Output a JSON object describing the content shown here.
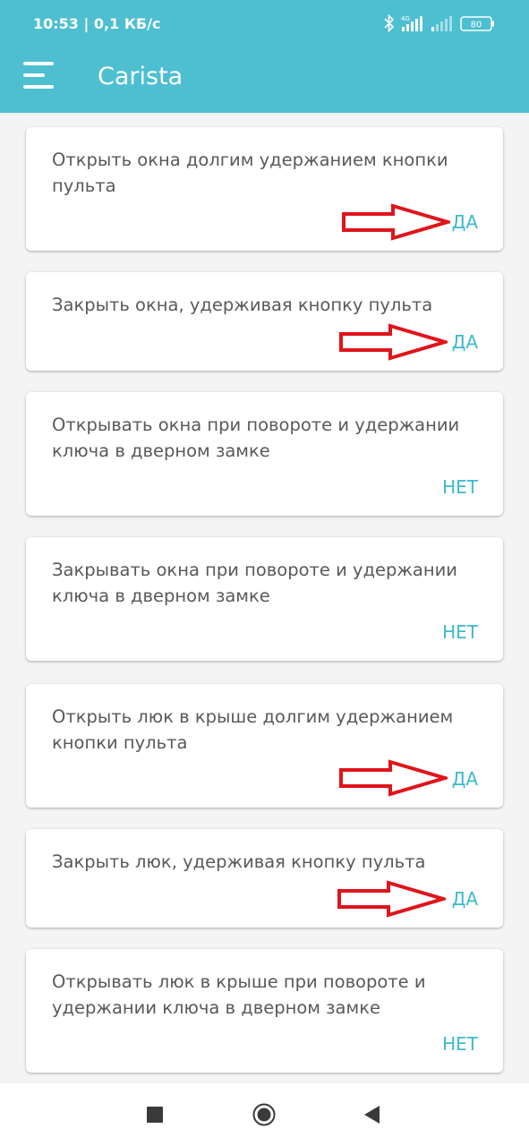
{
  "status_bar": {
    "time": "10:53 | 0,1 КБ/с",
    "network": "4G",
    "battery": "80",
    "icons": [
      "bluetooth-icon",
      "signal-4g-icon",
      "signal-icon",
      "battery-icon"
    ]
  },
  "app_bar": {
    "title": "Carista",
    "menu_icon": "hamburger-menu-icon"
  },
  "settings": [
    {
      "label": "Открыть окна долгим удержанием кнопки пульта",
      "value": "ДА",
      "annotated": true
    },
    {
      "label": "Закрыть окна, удерживая кнопку пульта",
      "value": "ДА",
      "annotated": true
    },
    {
      "label": "Открывать окна при повороте и удержании ключа в дверном замке",
      "value": "НЕТ",
      "annotated": false
    },
    {
      "label": "Закрывать окна при повороте и удержании ключа в дверном замке",
      "value": "НЕТ",
      "annotated": false
    },
    {
      "label": "Открыть люк в крыше долгим удержанием кнопки пульта",
      "value": "ДА",
      "annotated": true
    },
    {
      "label": "Закрыть люк, удерживая кнопку пульта",
      "value": "ДА",
      "annotated": true
    },
    {
      "label": "Открывать люк в крыше при повороте и удержании ключа в дверном замке",
      "value": "НЕТ",
      "annotated": false
    }
  ],
  "colors": {
    "header": "#4dbfd0",
    "accent": "#3db9cc",
    "annotation_arrow": "#e0141b",
    "background": "#f4f4f4"
  },
  "nav_bar": {
    "buttons": [
      "recents-square-icon",
      "home-circle-icon",
      "back-triangle-icon"
    ]
  }
}
